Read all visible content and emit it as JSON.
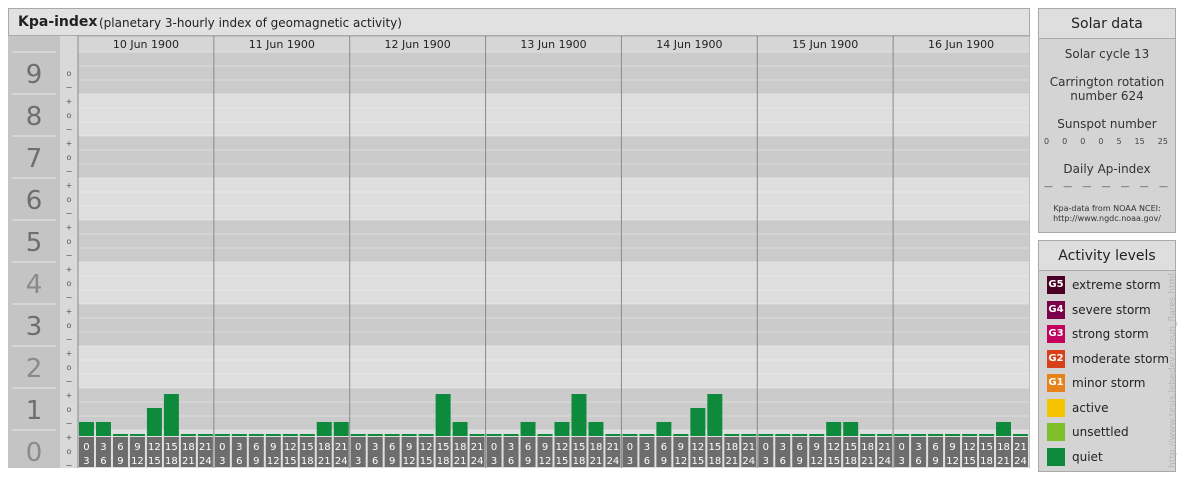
{
  "header": {
    "title": "Kpa-index",
    "subtitle": "(planetary 3-hourly index of geomagnetic activity)"
  },
  "chart_data": {
    "type": "bar",
    "ylim": [
      0,
      9
    ],
    "y_ticks": [
      "0",
      "1",
      "2",
      "3",
      "4",
      "5",
      "6",
      "7",
      "8",
      "9"
    ],
    "sub_ticks": [
      "+",
      "o",
      "−"
    ],
    "days": [
      "10 Jun 1900",
      "11 Jun 1900",
      "12 Jun 1900",
      "13 Jun 1900",
      "14 Jun 1900",
      "15 Jun 1900",
      "16 Jun 1900"
    ],
    "interval_start": [
      "0",
      "3",
      "6",
      "9",
      "12",
      "15",
      "18",
      "21"
    ],
    "interval_end": [
      "3",
      "6",
      "9",
      "12",
      "15",
      "18",
      "21",
      "24"
    ],
    "values": [
      [
        1.0,
        1.0,
        0.0,
        0.0,
        2.0,
        3.0,
        0.0,
        0.0
      ],
      [
        0.0,
        0.0,
        0.0,
        0.0,
        0.0,
        0.0,
        1.0,
        1.0
      ],
      [
        0.0,
        0.0,
        0.0,
        0.0,
        0.0,
        3.0,
        1.0,
        0.0
      ],
      [
        0.0,
        0.0,
        1.0,
        0.0,
        1.0,
        3.0,
        1.0,
        0.0
      ],
      [
        0.0,
        0.0,
        1.0,
        0.0,
        2.0,
        3.0,
        0.0,
        0.0
      ],
      [
        0.0,
        0.0,
        0.0,
        0.0,
        1.0,
        1.0,
        0.0,
        0.0
      ],
      [
        0.0,
        0.0,
        0.0,
        0.0,
        0.0,
        0.0,
        1.0,
        0.0
      ]
    ],
    "values_unit": "thirds of a Kp unit",
    "bar_color": "#0d8a3c",
    "band_color_dark": "#cbcbcb",
    "band_color_light": "#dedede"
  },
  "solar": {
    "heading": "Solar data",
    "solar_cycle": "Solar cycle 13",
    "carrington_line1": "Carrington rotation",
    "carrington_line2": "number 624",
    "sunspot_label": "Sunspot number",
    "sunspot_values": [
      "0",
      "0",
      "0",
      "0",
      "5",
      "15",
      "25"
    ],
    "ap_label": "Daily Ap-index",
    "ap_values": [
      "—",
      "—",
      "—",
      "—",
      "—",
      "—",
      "—"
    ],
    "credit_line1": "Kpa-data from NOAA NCEI:",
    "credit_line2": "http://www.ngdc.noaa.gov/"
  },
  "activity": {
    "heading": "Activity levels",
    "levels": [
      {
        "badge": "G5",
        "label": "extreme storm",
        "color": "#4a0024"
      },
      {
        "badge": "G4",
        "label": "severe storm",
        "color": "#7a0048"
      },
      {
        "badge": "G3",
        "label": "strong storm",
        "color": "#c4005f"
      },
      {
        "badge": "G2",
        "label": "moderate storm",
        "color": "#d8401a"
      },
      {
        "badge": "G1",
        "label": "minor storm",
        "color": "#e8821a"
      },
      {
        "badge": "",
        "label": "active",
        "color": "#f5c400"
      },
      {
        "badge": "",
        "label": "unsettled",
        "color": "#7fbf2a"
      },
      {
        "badge": "",
        "label": "quiet",
        "color": "#0d8a3c"
      }
    ]
  },
  "credit": {
    "vertical": "http://www.tesis.lebedev.ru/sun_flares.html"
  }
}
